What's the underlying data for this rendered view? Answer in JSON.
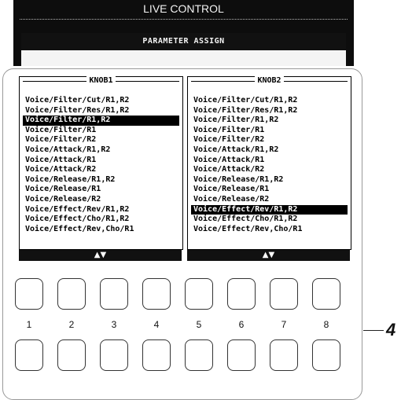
{
  "screen": {
    "title": "LIVE CONTROL",
    "header": "PARAMETER ASSIGN"
  },
  "knob1": {
    "title": "KNOB1",
    "items": [
      "Voice/Filter/Cut/R1,R2",
      "Voice/Filter/Res/R1,R2",
      "Voice/Filter/R1,R2",
      "Voice/Filter/R1",
      "Voice/Filter/R2",
      "Voice/Attack/R1,R2",
      "Voice/Attack/R1",
      "Voice/Attack/R2",
      "Voice/Release/R1,R2",
      "Voice/Release/R1",
      "Voice/Release/R2",
      "Voice/Effect/Rev/R1,R2",
      "Voice/Effect/Cho/R1,R2",
      "Voice/Effect/Rev,Cho/R1"
    ],
    "selected_index": 2,
    "scroll_label": "▲▼"
  },
  "knob2": {
    "title": "KNOB2",
    "items": [
      "Voice/Filter/Cut/R1,R2",
      "Voice/Filter/Res/R1,R2",
      "Voice/Filter/R1,R2",
      "Voice/Filter/R1",
      "Voice/Filter/R2",
      "Voice/Attack/R1,R2",
      "Voice/Attack/R1",
      "Voice/Attack/R2",
      "Voice/Release/R1,R2",
      "Voice/Release/R1",
      "Voice/Release/R2",
      "Voice/Effect/Rev/R1,R2",
      "Voice/Effect/Cho/R1,R2",
      "Voice/Effect/Rev,Cho/R1"
    ],
    "selected_index": 11,
    "scroll_label": "▲▼"
  },
  "buttons": {
    "numbers": [
      "1",
      "2",
      "3",
      "4",
      "5",
      "6",
      "7",
      "8"
    ]
  },
  "callout": {
    "label": "4"
  }
}
